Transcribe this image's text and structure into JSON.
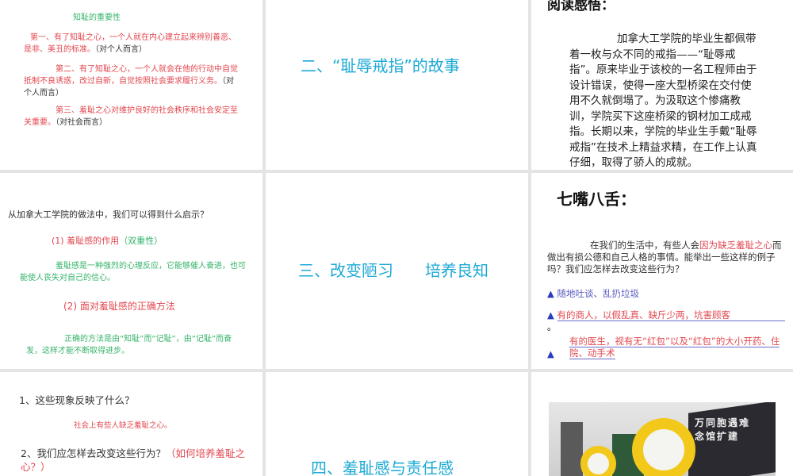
{
  "slides": [
    {
      "heading": "知耻的重要性",
      "p1": "第一、有了知耻之心，一个人就在内心建立起来辨别善恶、是非、美丑的标准。",
      "p1_note": "（对个人而言）",
      "p2": "第二、有了知耻之心，一个人就会在他的行动中自觉抵制不良诱惑，改过自新，自觉按照社会要求履行义务。",
      "p2_note": "（对个人而言）",
      "p3": "第三、羞耻之心对维护良好的社会秩序和社会安定至关重要。",
      "p3_note": "（对社会而言）"
    },
    {
      "title": "二、“耻辱戒指”的故事"
    },
    {
      "heading": "阅读感悟：",
      "body": "加拿大工学院的毕业生都佩带着一枚与众不同的戒指——“耻辱戒指”。原来毕业于该校的一名工程师由于设计错误，使得一座大型桥梁在交付使用不久就倒塌了。为汲取这个惨痛教训，学院买下这座桥梁的钢材加工成戒指。长期以来，学院的毕业生手戴“耻辱戒指”在技术上精益求精，在工作上认真仔细，取得了骄人的成就。"
    },
    {
      "question": "从加拿大工学院的做法中，我们可以得到什么启示？",
      "h1": "(1)  羞耻感的作用",
      "h1_note": "（双重性）",
      "p1": "羞耻感是一种强烈的心理反应，它能够催人奋进，也可能使人丧失对自己的信心。",
      "h2": "(2) 面对羞耻感的正确方法",
      "p2": "正确的方法是由“知耻”而“记耻”，由“记耻”而奋发，这样才能不断取得进步。"
    },
    {
      "title": "三、改变陋习　　培养良知"
    },
    {
      "heading": "七嘴八舌：",
      "intro_a": "在我们的生活中，有些人会",
      "intro_red": "因为缺乏羞耻之心",
      "intro_b": "而做出有损公德和自己人格的事情。能举出一些这样的例子吗？我们应怎样去改变这些行为？",
      "bullets": [
        "随地吐谈、乱扔垃圾",
        "有的商人，以假乱真、缺斤少两，坑害顾客",
        "有的医生，视有无“红包”以及“红包”的大小开药、住院、动手术"
      ],
      "bullet_icon": "triangle-icon"
    },
    {
      "q1": "1、这些现象反映了什么？",
      "a1": "社会上有些人缺乏羞耻之心。",
      "q2": "2、我们应怎样去改变这些行为？",
      "q2_red": "（如何培养羞耻之心？）"
    },
    {
      "title": "四、羞耻感与责任感"
    },
    {
      "photo_sign": "万同胞遇难 念馆扩建"
    }
  ]
}
